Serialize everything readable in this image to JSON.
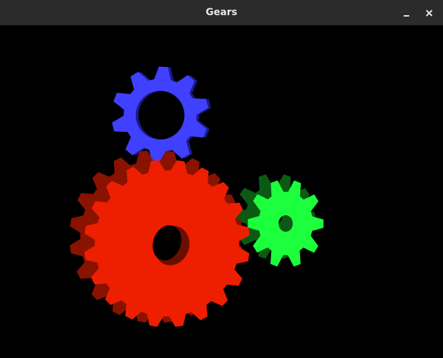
{
  "window": {
    "title": "Gears",
    "minimize_icon": "minimize-icon",
    "close_icon": "close-icon"
  },
  "scene": {
    "background": "#000000",
    "gears": [
      {
        "name": "red-gear",
        "color": "#ee1f00",
        "side_color": "#8a1200",
        "teeth": 20
      },
      {
        "name": "green-gear",
        "color": "#1cff3c",
        "side_color": "#0a5a14",
        "teeth": 10
      },
      {
        "name": "blue-gear",
        "color": "#4040ff",
        "side_color": "#1a1a8a",
        "teeth": 10
      }
    ]
  }
}
